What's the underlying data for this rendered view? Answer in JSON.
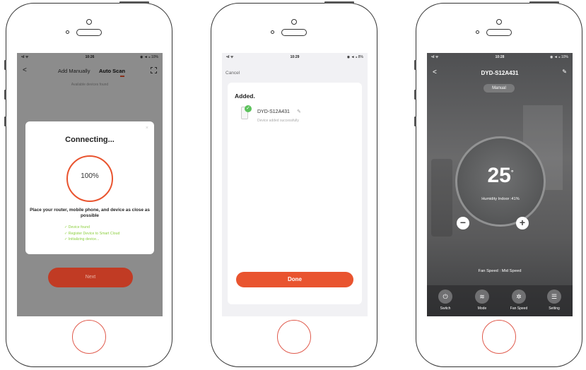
{
  "screen1": {
    "status_time": "10:26",
    "status_left": "•ıl ᯤ",
    "status_right": "◉ ◄ ⁎ 10%",
    "back_glyph": "<",
    "tab_manual": "Add Manually",
    "tab_auto": "Auto Scan",
    "available_text": "Available devices found",
    "dialog_close": "×",
    "dialog_title": "Connecting...",
    "progress": "100%",
    "message": "Place your router, mobile phone, and device as close as possible",
    "steps": [
      "✓ Device found",
      "✓ Register Device to Smart Cloud",
      "✓ Initializing device..."
    ],
    "next_label": "Next"
  },
  "screen2": {
    "status_time": "10:29",
    "status_left": "•ıl ᯤ",
    "status_right": "◉ ◄ ⁎ 8%",
    "cancel_label": "Cancel",
    "added_label": "Added.",
    "check_glyph": "✓",
    "device_name": "DYD-S12A431",
    "edit_glyph": "✎",
    "device_sub": "Device added successfully",
    "done_label": "Done"
  },
  "screen3": {
    "status_time": "10:28",
    "status_left": "•ıl ᯤ",
    "status_right": "◉ ◄ ⁎ 10%",
    "back_glyph": "<",
    "title": "DYD-S12A431",
    "edit_glyph": "✎",
    "mode_pill": "Manual",
    "temperature": "25",
    "degree_glyph": "°",
    "humidity": "Humidity Indoor :41%",
    "minus_glyph": "−",
    "plus_glyph": "+",
    "fan_speed": "Fan Speed : Mid Speed",
    "bottom_items": [
      {
        "icon": "⏻",
        "label": "Switch"
      },
      {
        "icon": "≋",
        "label": "Mode"
      },
      {
        "icon": "✲",
        "label": "Fan Speed"
      },
      {
        "icon": "☰",
        "label": "Setting"
      }
    ]
  },
  "colors": {
    "accent": "#e9542f",
    "success": "#5cc25c",
    "step_text": "#8ccf3f",
    "home_button": "#e05a4c"
  }
}
